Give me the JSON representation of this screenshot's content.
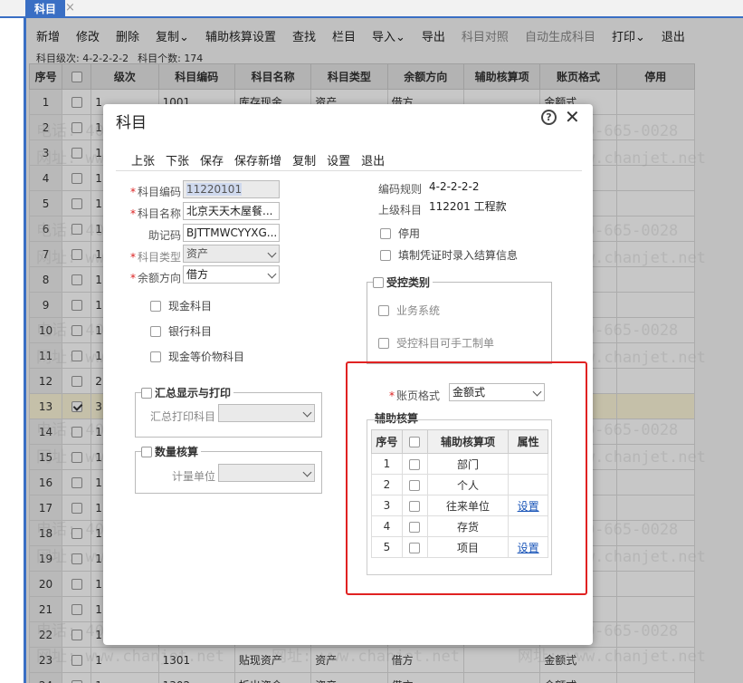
{
  "tab": {
    "label": "科目",
    "close": "×"
  },
  "toolbar": {
    "items": [
      "新增",
      "修改",
      "删除",
      "复制⌄",
      "辅助核算设置",
      "查找",
      "栏目",
      "导入⌄",
      "导出",
      "科目对照",
      "自动生成科目",
      "打印⌄",
      "退出"
    ]
  },
  "info": {
    "level_label": "科目级次:",
    "level_value": "4-2-2-2-2",
    "count_label": "科目个数:",
    "count_value": "174"
  },
  "grid": {
    "headers": [
      "序号",
      "",
      "级次",
      "科目编码",
      "科目名称",
      "科目类型",
      "余额方向",
      "辅助核算项",
      "账页格式",
      "停用"
    ],
    "rows": [
      {
        "no": "1",
        "level": "1",
        "code": "1001",
        "name": "库存现金",
        "type": "资产",
        "dir": "借方",
        "fmt": "金额式"
      },
      {
        "no": "2",
        "level": "1",
        "code": "",
        "name": "",
        "type": "",
        "dir": "",
        "fmt": ""
      },
      {
        "no": "3",
        "level": "1",
        "code": "",
        "name": "",
        "type": "",
        "dir": "",
        "fmt": ""
      },
      {
        "no": "4",
        "level": "1",
        "code": "",
        "name": "",
        "type": "",
        "dir": "",
        "fmt": ""
      },
      {
        "no": "5",
        "level": "1",
        "code": "",
        "name": "",
        "type": "",
        "dir": "",
        "fmt": ""
      },
      {
        "no": "6",
        "level": "1",
        "code": "",
        "name": "",
        "type": "",
        "dir": "",
        "fmt": ""
      },
      {
        "no": "7",
        "level": "1",
        "code": "",
        "name": "",
        "type": "",
        "dir": "",
        "fmt": ""
      },
      {
        "no": "8",
        "level": "1",
        "code": "",
        "name": "",
        "type": "",
        "dir": "",
        "fmt": ""
      },
      {
        "no": "9",
        "level": "1",
        "code": "",
        "name": "",
        "type": "",
        "dir": "",
        "fmt": ""
      },
      {
        "no": "10",
        "level": "1",
        "code": "",
        "name": "",
        "type": "",
        "dir": "",
        "fmt": ""
      },
      {
        "no": "11",
        "level": "1",
        "code": "",
        "name": "",
        "type": "",
        "dir": "",
        "fmt": ""
      },
      {
        "no": "12",
        "level": "2",
        "code": "",
        "name": "",
        "type": "",
        "dir": "",
        "fmt": ""
      },
      {
        "no": "13",
        "level": "3",
        "code": "",
        "name": "",
        "type": "",
        "dir": "",
        "fmt": "",
        "selected": true
      },
      {
        "no": "14",
        "level": "1",
        "code": "",
        "name": "",
        "type": "",
        "dir": "",
        "fmt": ""
      },
      {
        "no": "15",
        "level": "1",
        "code": "",
        "name": "",
        "type": "",
        "dir": "",
        "fmt": ""
      },
      {
        "no": "16",
        "level": "1",
        "code": "",
        "name": "",
        "type": "",
        "dir": "",
        "fmt": ""
      },
      {
        "no": "17",
        "level": "1",
        "code": "",
        "name": "",
        "type": "",
        "dir": "",
        "fmt": ""
      },
      {
        "no": "18",
        "level": "1",
        "code": "",
        "name": "",
        "type": "",
        "dir": "",
        "fmt": ""
      },
      {
        "no": "19",
        "level": "1",
        "code": "",
        "name": "",
        "type": "",
        "dir": "",
        "fmt": ""
      },
      {
        "no": "20",
        "level": "1",
        "code": "",
        "name": "",
        "type": "",
        "dir": "",
        "fmt": ""
      },
      {
        "no": "21",
        "level": "1",
        "code": "",
        "name": "",
        "type": "",
        "dir": "",
        "fmt": ""
      },
      {
        "no": "22",
        "level": "1",
        "code": "",
        "name": "",
        "type": "",
        "dir": "",
        "fmt": ""
      },
      {
        "no": "23",
        "level": "1",
        "code": "1301",
        "name": "贴现资产",
        "type": "资产",
        "dir": "借方",
        "fmt": "金额式"
      },
      {
        "no": "24",
        "level": "1",
        "code": "1302",
        "name": "拆出资金",
        "type": "资产",
        "dir": "借方",
        "fmt": "金额式"
      }
    ]
  },
  "dialog": {
    "title": "科目",
    "help": "?",
    "close": "✕",
    "toolbar": [
      "上张",
      "下张",
      "保存",
      "保存新增",
      "复制",
      "设置",
      "退出"
    ],
    "form": {
      "code_label": "科目编码",
      "code_value": "11220101",
      "name_label": "科目名称",
      "name_value": "北京天天木屋餐...",
      "mnemonic_label": "助记码",
      "mnemonic_value": "BJTTMWCYYXG...",
      "type_label": "科目类型",
      "type_value": "资产",
      "dir_label": "余额方向",
      "dir_value": "借方",
      "cash_label": "现金科目",
      "bank_label": "银行科目",
      "cash_eq_label": "现金等价物科目",
      "rule_label": "编码规则",
      "rule_value": "4-2-2-2-2",
      "parent_label": "上级科目",
      "parent_value": "112201 工程款",
      "disable_label": "停用",
      "settle_label": "填制凭证时录入结算信息",
      "controlled_title": "受控类别",
      "business_label": "业务系统",
      "manual_label": "受控科目可手工制单",
      "summary_title": "汇总显示与打印",
      "summary_print_label": "汇总打印科目",
      "qty_title": "数量核算",
      "unit_label": "计量单位",
      "page_fmt_label": "账页格式",
      "page_fmt_value": "金额式",
      "aux_title": "辅助核算"
    },
    "aux_table": {
      "headers": [
        "序号",
        "",
        "辅助核算项",
        "属性"
      ],
      "rows": [
        {
          "no": "1",
          "item": "部门",
          "attr": ""
        },
        {
          "no": "2",
          "item": "个人",
          "attr": ""
        },
        {
          "no": "3",
          "item": "往来单位",
          "attr": "设置"
        },
        {
          "no": "4",
          "item": "存货",
          "attr": ""
        },
        {
          "no": "5",
          "item": "项目",
          "attr": "设置"
        }
      ]
    }
  },
  "watermark": {
    "phone": "电话: 400-665-0028",
    "site": "网址: www.chanjet.net"
  }
}
